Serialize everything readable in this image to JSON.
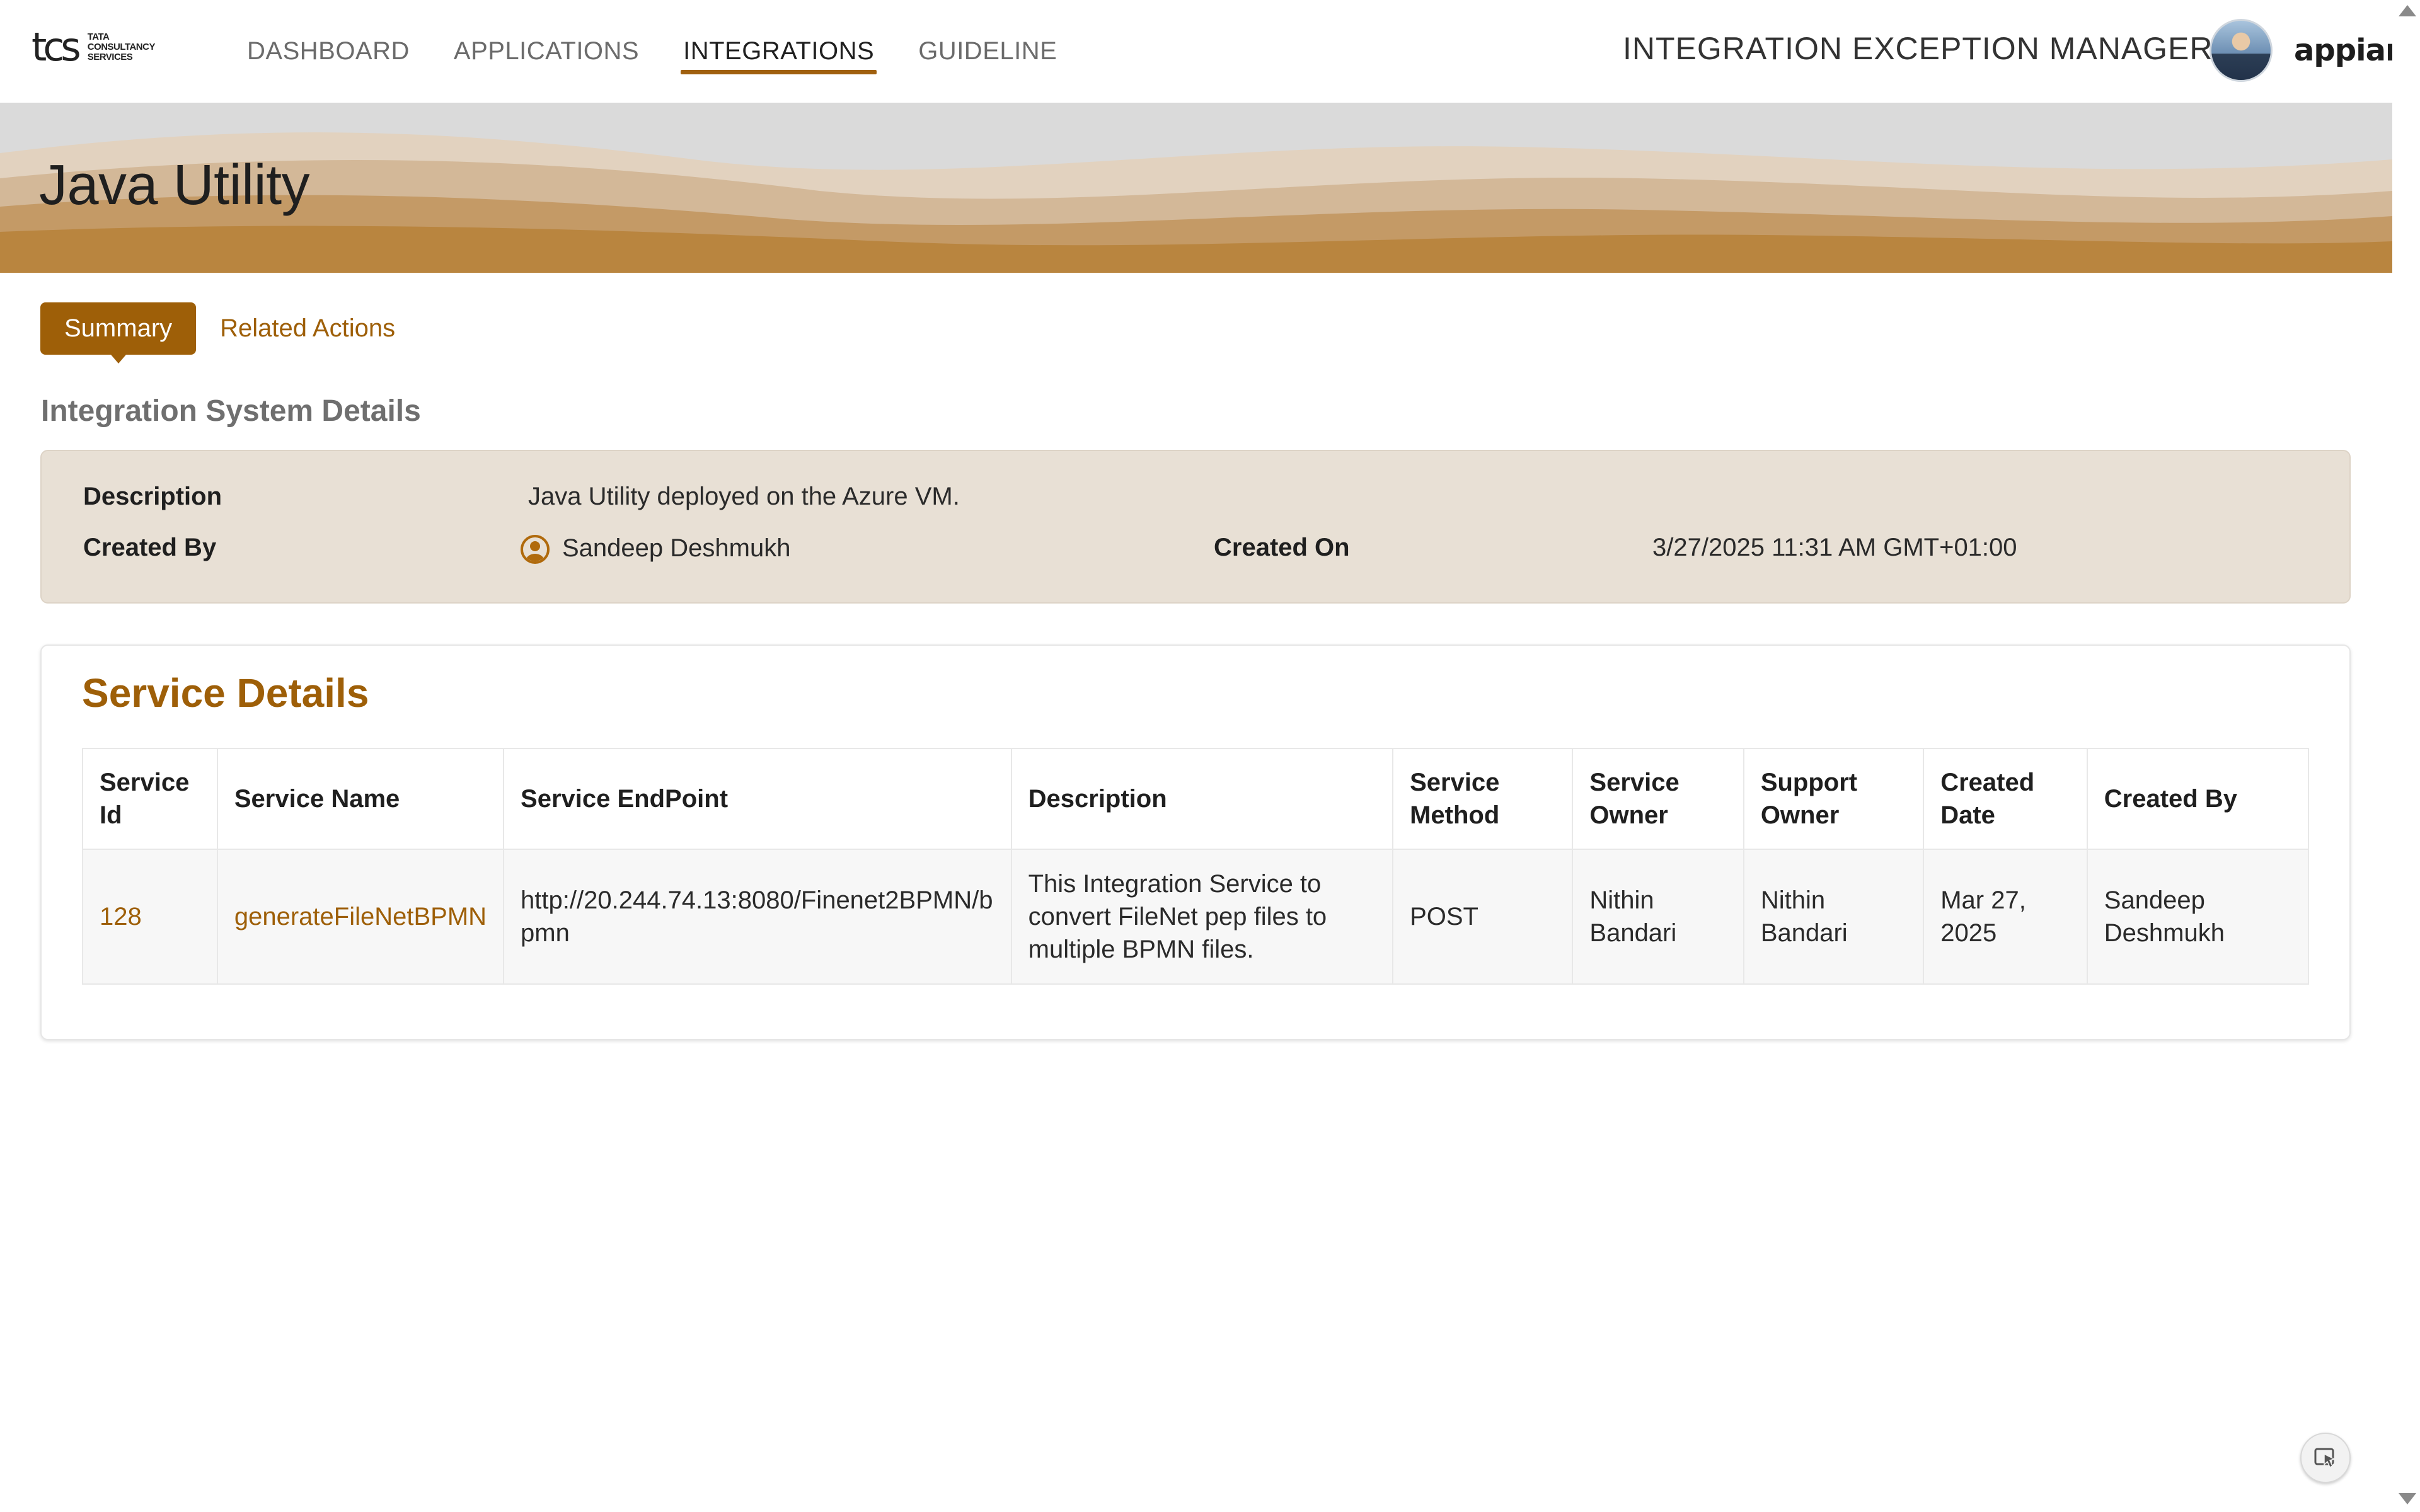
{
  "header": {
    "logo": {
      "mark": "tcs",
      "lines": [
        "TATA",
        "CONSULTANCY",
        "SERVICES"
      ]
    },
    "nav": [
      {
        "label": "DASHBOARD",
        "active": false
      },
      {
        "label": "APPLICATIONS",
        "active": false
      },
      {
        "label": "INTEGRATIONS",
        "active": true
      },
      {
        "label": "GUIDELINE",
        "active": false
      }
    ],
    "app_switcher": "INTEGRATION EXCEPTION MANAGER",
    "brand": "appian",
    "accent_color": "#9e5f08"
  },
  "page": {
    "title": "Java Utility"
  },
  "tabs": {
    "summary": "Summary",
    "related": "Related Actions"
  },
  "system_details": {
    "heading": "Integration System Details",
    "description_label": "Description",
    "description_value": "Java Utility deployed on the Azure VM.",
    "created_by_label": "Created By",
    "created_by_value": "Sandeep Deshmukh",
    "created_on_label": "Created On",
    "created_on_value": "3/27/2025 11:31 AM GMT+01:00"
  },
  "service_details": {
    "title": "Service Details",
    "columns": [
      "Service Id",
      "Service Name",
      "Service EndPoint",
      "Description",
      "Service Method",
      "Service Owner",
      "Support Owner",
      "Created Date",
      "Created By"
    ],
    "rows": [
      {
        "id": "128",
        "name": "generateFileNetBPMN",
        "endpoint": "http://20.244.74.13:8080/Finenet2BPMN/bpmn",
        "description": "This Integration Service to convert FileNet pep files to multiple BPMN files.",
        "method": "POST",
        "service_owner": "Nithin Bandari",
        "support_owner": "Nithin Bandari",
        "created_date": "Mar 27, 2025",
        "created_by": "Sandeep Deshmukh"
      }
    ]
  }
}
